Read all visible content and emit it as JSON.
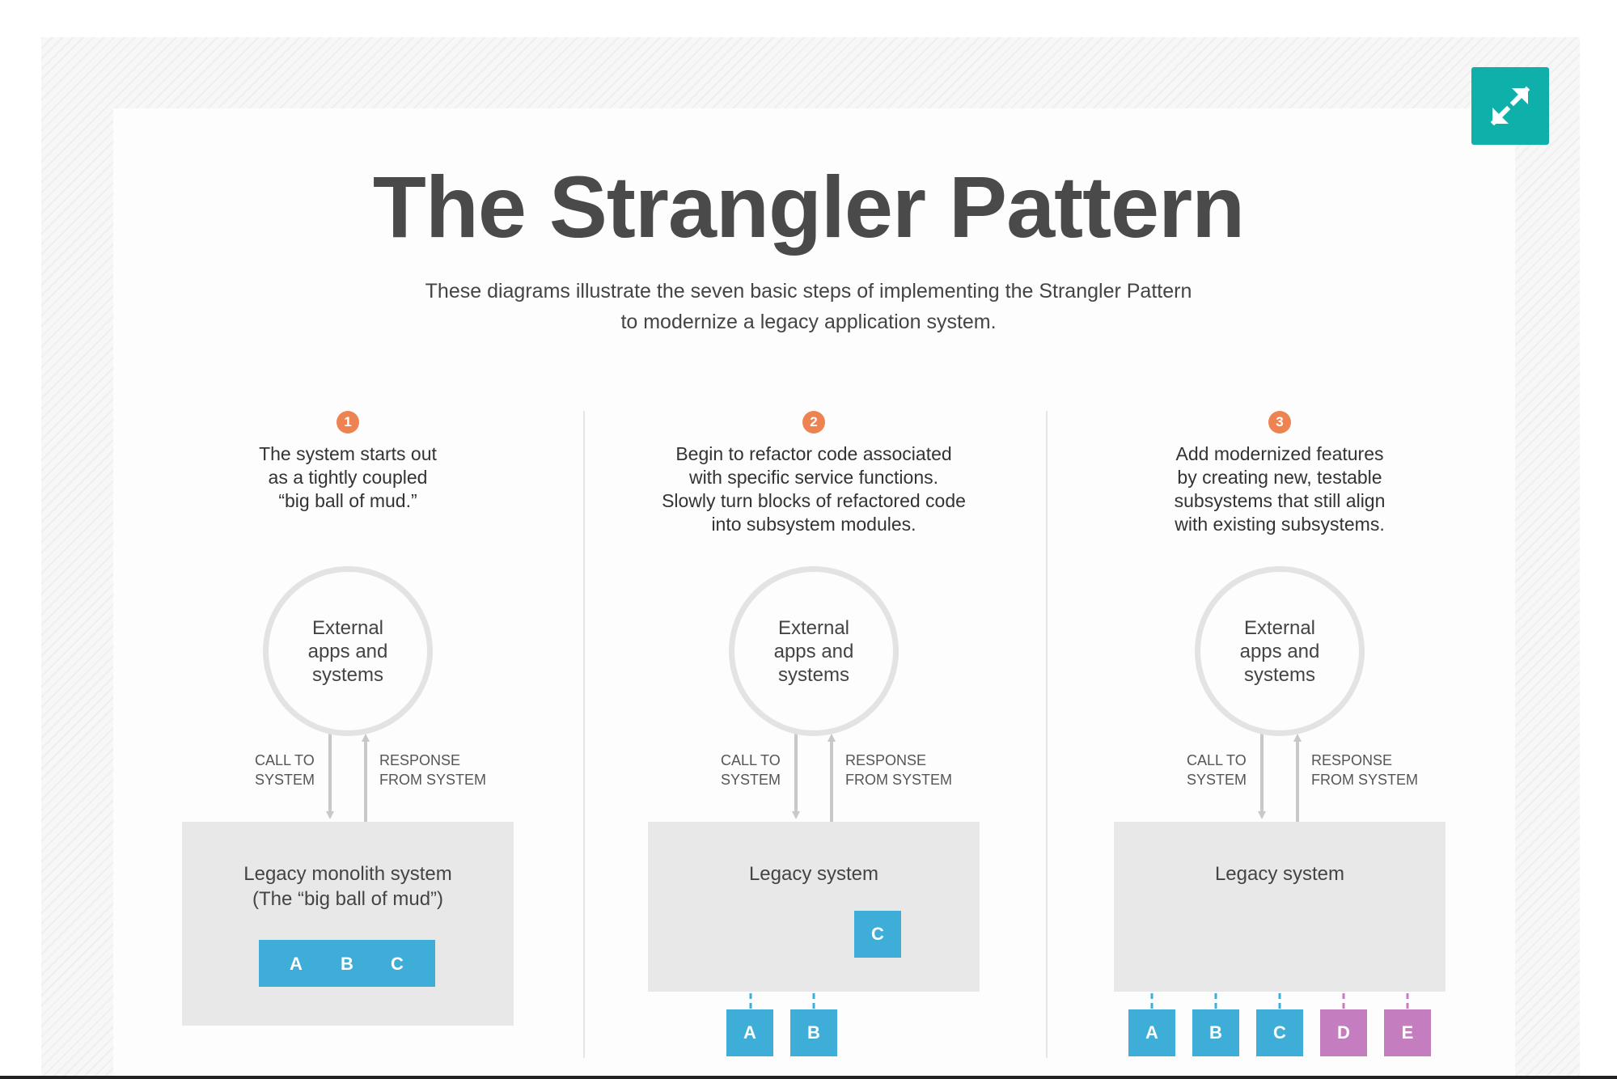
{
  "title": "The Strangler Pattern",
  "subtitle": [
    "These diagrams illustrate the seven basic steps of implementing the Strangler Pattern",
    "to modernize a legacy application system."
  ],
  "colors": {
    "accent": "#10b0aa",
    "step_badge": "#ee8352",
    "module_blue": "#3eaed8",
    "module_purple": "#c47ec0",
    "legacy_box": "#e8e8e8"
  },
  "expand_icon": "expand-arrows-icon",
  "steps": [
    {
      "number": "1",
      "description": [
        "The system starts out",
        "as a tightly coupled",
        "“big ball of mud.”"
      ],
      "circle": [
        "External",
        "apps and",
        "systems"
      ],
      "call_label": [
        "CALL TO",
        "SYSTEM"
      ],
      "response_label": [
        "RESPONSE",
        "FROM SYSTEM"
      ],
      "legacy_label": [
        "Legacy monolith system",
        "(The “big ball of mud”)"
      ],
      "inner_modules": [
        "A",
        "B",
        "C"
      ]
    },
    {
      "number": "2",
      "description": [
        "Begin to refactor code associated",
        "with specific service functions.",
        "Slowly turn blocks of refactored code",
        "into subsystem modules."
      ],
      "circle": [
        "External",
        "apps and",
        "systems"
      ],
      "call_label": [
        "CALL TO",
        "SYSTEM"
      ],
      "response_label": [
        "RESPONSE",
        "FROM SYSTEM"
      ],
      "legacy_label": [
        "Legacy system"
      ],
      "inner_modules": [
        "C"
      ],
      "outer_modules": [
        "A",
        "B"
      ]
    },
    {
      "number": "3",
      "description": [
        "Add modernized features",
        "by creating new, testable",
        "subsystems that still align",
        "with existing subsystems."
      ],
      "circle": [
        "External",
        "apps and",
        "systems"
      ],
      "call_label": [
        "CALL TO",
        "SYSTEM"
      ],
      "response_label": [
        "RESPONSE",
        "FROM SYSTEM"
      ],
      "legacy_label": [
        "Legacy system"
      ],
      "outer_modules": [
        "A",
        "B",
        "C",
        "D",
        "E"
      ]
    }
  ]
}
